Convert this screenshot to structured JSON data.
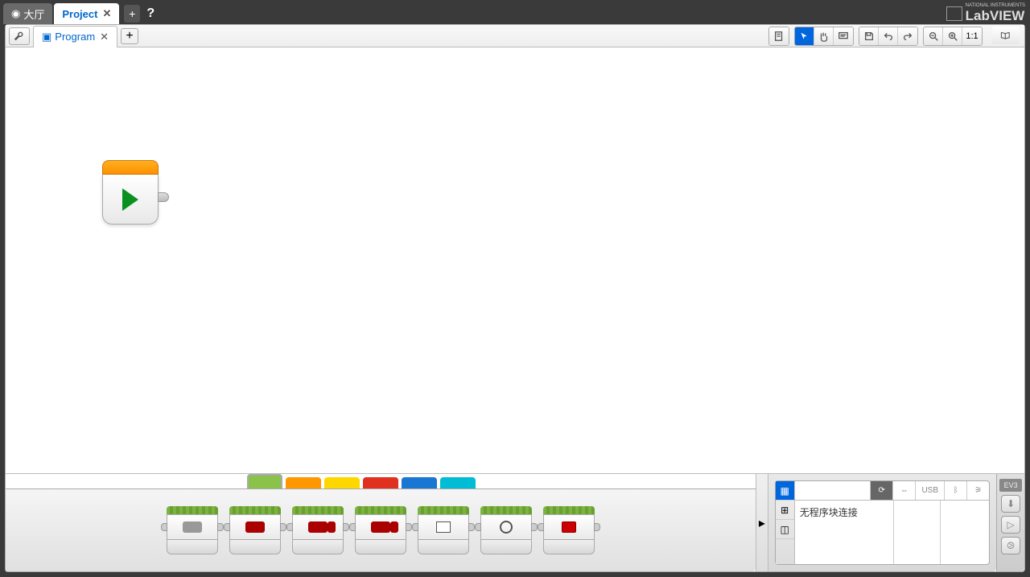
{
  "top_tabs": {
    "lobby": "大厅",
    "project": "Project"
  },
  "sub_tab": "Program",
  "brand": {
    "sub": "NATIONAL INSTRUMENTS",
    "name": "LabVIEW"
  },
  "zoom_reset": "1:1",
  "conn_usb": "USB",
  "status_msg": "无程序块连接",
  "ev3_label": "EV3",
  "palette_categories": [
    "green",
    "orange",
    "yellow",
    "red",
    "blue",
    "teal"
  ],
  "palette_blocks": [
    "medium-motor",
    "large-motor",
    "move-steering",
    "move-tank",
    "display",
    "sound",
    "brick-status-light"
  ]
}
